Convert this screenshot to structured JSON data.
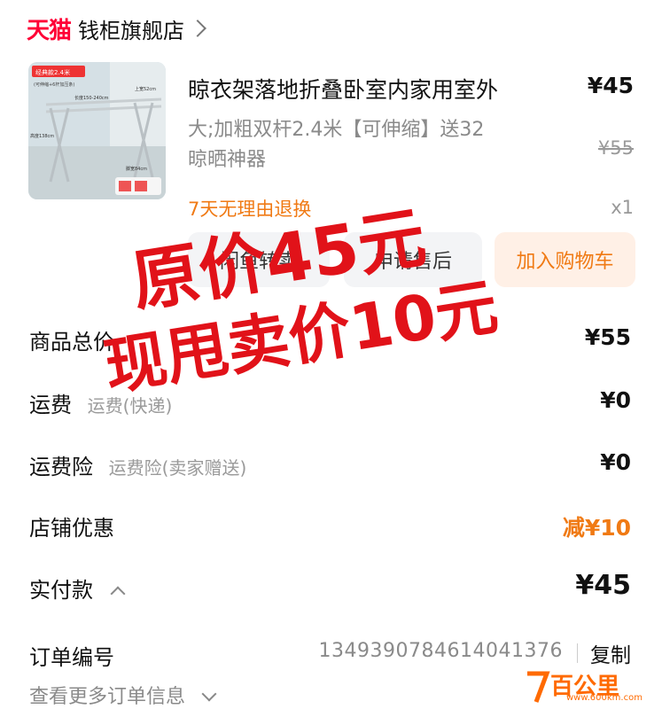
{
  "header": {
    "platform_logo": "天猫",
    "shop_name": "钱柜旗舰店"
  },
  "product": {
    "title": "晾衣架落地折叠卧室内家用室外",
    "price": "¥45",
    "spec_line1": "大;加粗双杆2.4米【可伸缩】送32",
    "spec_line2": "晾晒神器",
    "original_price": "¥55",
    "return_policy": "7天无理由退换",
    "quantity": "x1",
    "thumb_labels": {
      "badge": "经典款2.4米",
      "sub": "(可伸缩+6杆加压条)",
      "w": "长度150-240cm",
      "h": "上宽52cm",
      "side": "高度138cm",
      "foot": "脚宽84cm"
    }
  },
  "actions": {
    "resell": "闲鱼转卖",
    "after_sales": "申请售后",
    "add_to_cart": "加入购物车"
  },
  "summary": {
    "goods_total_label": "商品总价",
    "goods_total_value": "¥55",
    "shipping_label": "运费",
    "shipping_sub": "运费(快递)",
    "shipping_value": "¥0",
    "insurance_label": "运费险",
    "insurance_sub": "运费险(卖家赠送)",
    "insurance_value": "¥0",
    "shop_discount_label": "店铺优惠",
    "shop_discount_value": "减¥10",
    "paid_label": "实付款",
    "paid_value": "¥45"
  },
  "order": {
    "number_label": "订单编号",
    "number_value": "1349390784614041376",
    "copy_label": "复制",
    "more_info": "查看更多订单信息"
  },
  "overlay": {
    "line1": "原价45元",
    "line2": "现甩卖价10元"
  },
  "watermark": {
    "text": "百公里",
    "url": "www.600km.com"
  },
  "colors": {
    "tmall_red": "#ff0036",
    "discount_orange": "#f07a14",
    "overlay_red": "#e11219"
  }
}
